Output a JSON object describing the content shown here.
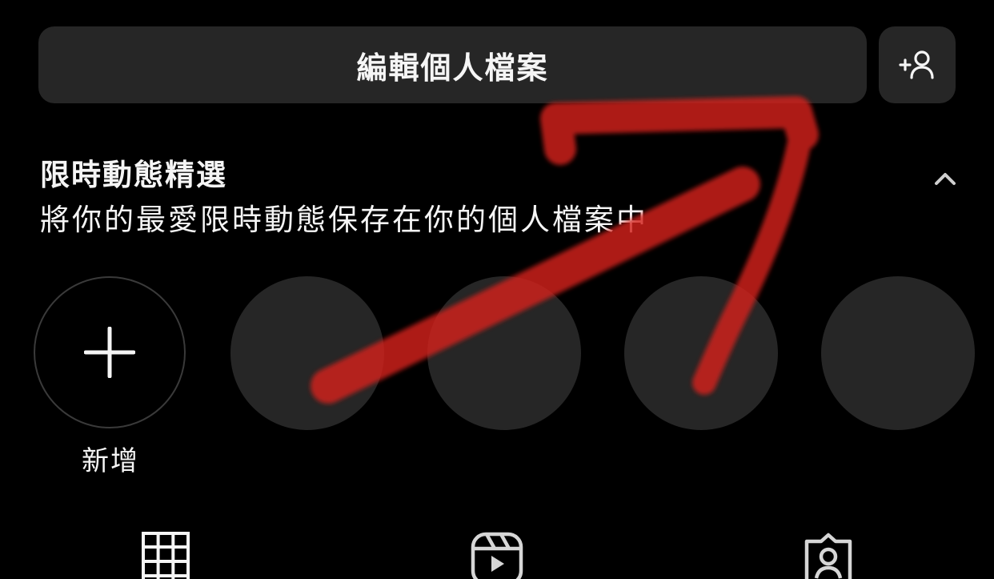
{
  "profile_actions": {
    "edit_profile_label": "編輯個人檔案"
  },
  "highlights": {
    "title": "限時動態精選",
    "subtitle": "將你的最愛限時動態保存在你的個人檔案中",
    "new_label": "新增"
  },
  "icons": {
    "add_person": "add-person-icon",
    "chevron": "chevron-up-icon",
    "plus": "plus-icon",
    "grid": "grid-icon",
    "reels": "reels-icon",
    "tagged": "tagged-icon"
  },
  "colors": {
    "background": "#000000",
    "button_bg": "#262626",
    "text": "#f5f5f5",
    "annotation": "#d4221b"
  }
}
